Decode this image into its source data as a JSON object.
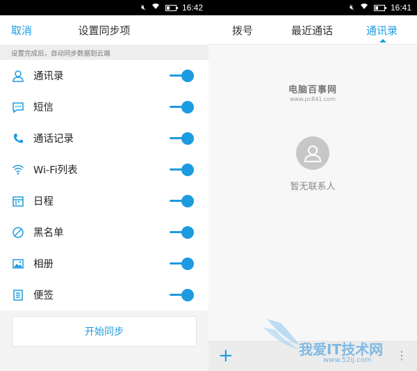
{
  "left": {
    "status": {
      "time": "16:42",
      "battery_level": 0.35
    },
    "header": {
      "cancel_label": "取消",
      "title": "设置同步项"
    },
    "note": "设置完成后，自动同步数据到云端",
    "items": [
      {
        "label": "通讯录",
        "icon": "contact-icon",
        "enabled": true
      },
      {
        "label": "短信",
        "icon": "message-icon",
        "enabled": true
      },
      {
        "label": "通话记录",
        "icon": "phone-icon",
        "enabled": true
      },
      {
        "label": "Wi-Fi列表",
        "icon": "wifi-icon",
        "enabled": true
      },
      {
        "label": "日程",
        "icon": "calendar-icon",
        "enabled": true
      },
      {
        "label": "黑名单",
        "icon": "block-icon",
        "enabled": true
      },
      {
        "label": "相册",
        "icon": "image-icon",
        "enabled": true
      },
      {
        "label": "便签",
        "icon": "note-icon",
        "enabled": true
      }
    ],
    "sync_button_label": "开始同步"
  },
  "right": {
    "status": {
      "time": "16:41",
      "battery_level": 0.35
    },
    "tabs": [
      {
        "label": "拨号",
        "active": false
      },
      {
        "label": "最近通话",
        "active": false
      },
      {
        "label": "通讯录",
        "active": true
      }
    ],
    "watermark": {
      "title": "电脑百事网",
      "url": "www.pc841.com"
    },
    "empty_text": "暂无联系人",
    "bottom_watermark": {
      "title": "我爱IT技术网",
      "url": "www.52ij.com"
    }
  },
  "colors": {
    "accent": "#1c9be0",
    "avatar": "#c7c7c7",
    "note_bg": "#eeeeee"
  }
}
